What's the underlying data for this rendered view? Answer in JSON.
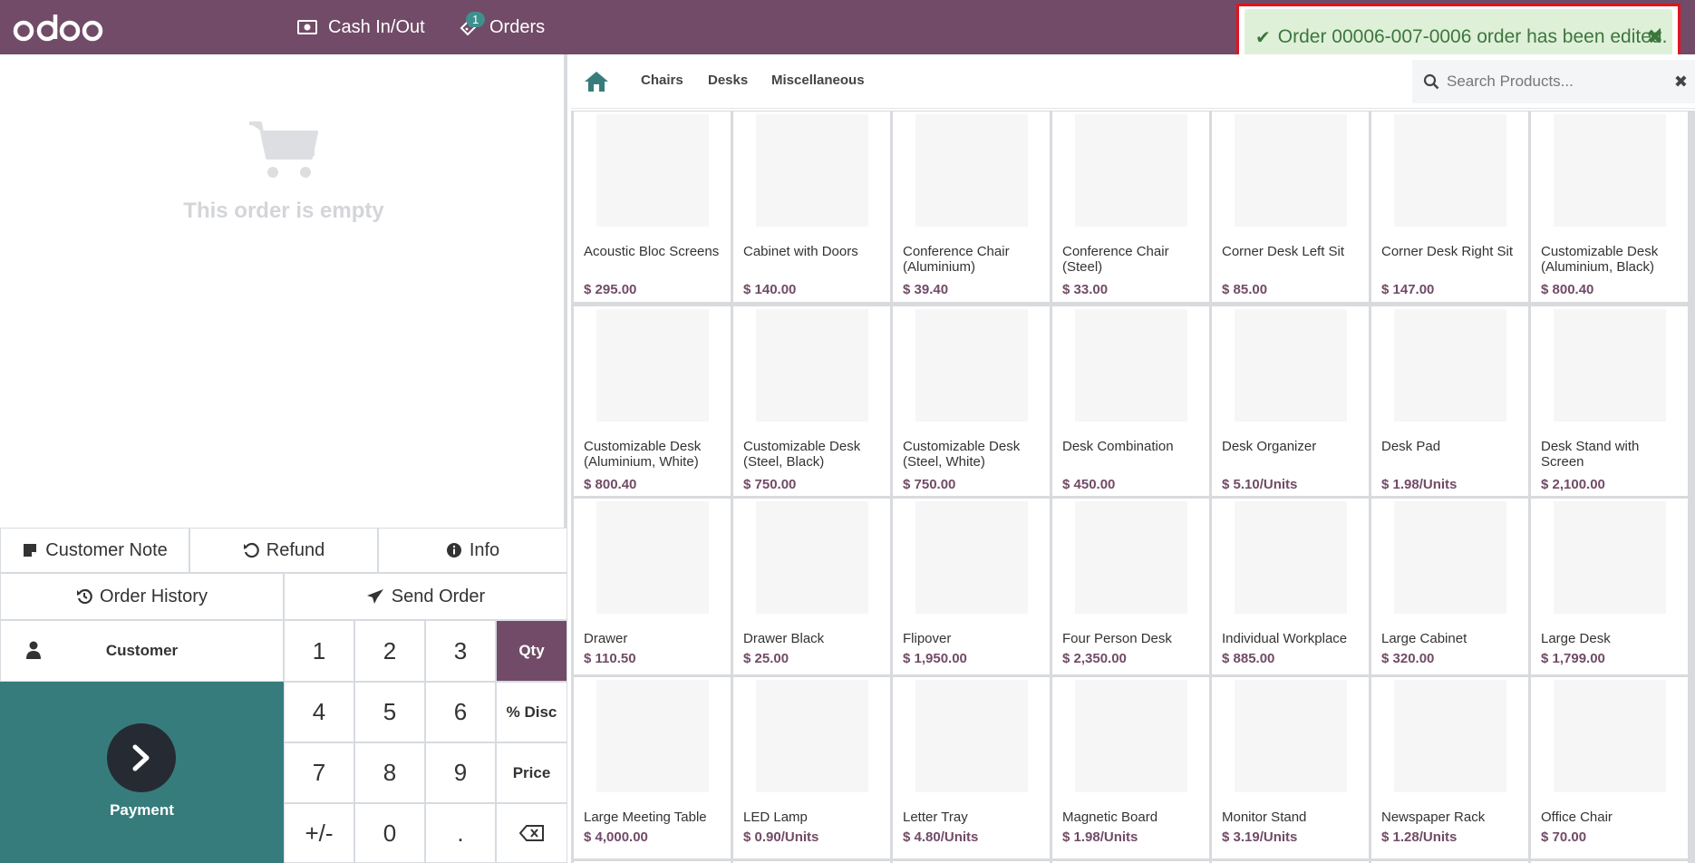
{
  "topbar": {
    "cash_label": "Cash In/Out",
    "orders_label": "Orders",
    "orders_badge": "1"
  },
  "toast": {
    "message": "Order 00006-007-0006 order has been edited.",
    "icon": "check-icon",
    "close": "✖"
  },
  "order": {
    "empty_text": "This order is empty"
  },
  "controls": {
    "customer_note": "Customer Note",
    "refund": "Refund",
    "info": "Info",
    "order_history": "Order History",
    "send_order": "Send Order"
  },
  "customer_label": "Customer",
  "payment_label": "Payment",
  "numpad": {
    "keys": [
      "1",
      "2",
      "3",
      "Qty",
      "4",
      "5",
      "6",
      "% Disc",
      "7",
      "8",
      "9",
      "Price",
      "+/-",
      "0",
      "."
    ],
    "active_mode": "Qty"
  },
  "categories": [
    "Chairs",
    "Desks",
    "Miscellaneous"
  ],
  "search": {
    "placeholder": "Search Products..."
  },
  "products": [
    {
      "name": "Acoustic Bloc Screens",
      "price": "$ 295.00"
    },
    {
      "name": "Cabinet with Doors",
      "price": "$ 140.00"
    },
    {
      "name": "Conference Chair (Aluminium)",
      "price": "$ 39.40"
    },
    {
      "name": "Conference Chair (Steel)",
      "price": "$ 33.00"
    },
    {
      "name": "Corner Desk Left Sit",
      "price": "$ 85.00"
    },
    {
      "name": "Corner Desk Right Sit",
      "price": "$ 147.00"
    },
    {
      "name": "Customizable Desk (Aluminium, Black)",
      "price": "$ 800.40"
    },
    {
      "name": "Customizable Desk (Aluminium, White)",
      "price": "$ 800.40"
    },
    {
      "name": "Customizable Desk (Steel, Black)",
      "price": "$ 750.00"
    },
    {
      "name": "Customizable Desk (Steel, White)",
      "price": "$ 750.00"
    },
    {
      "name": "Desk Combination",
      "price": "$ 450.00"
    },
    {
      "name": "Desk Organizer",
      "price": "$ 5.10/Units"
    },
    {
      "name": "Desk Pad",
      "price": "$ 1.98/Units"
    },
    {
      "name": "Desk Stand with Screen",
      "price": "$ 2,100.00"
    },
    {
      "name": "Drawer",
      "price": "$ 110.50"
    },
    {
      "name": "Drawer Black",
      "price": "$ 25.00"
    },
    {
      "name": "Flipover",
      "price": "$ 1,950.00"
    },
    {
      "name": "Four Person Desk",
      "price": "$ 2,350.00"
    },
    {
      "name": "Individual Workplace",
      "price": "$ 885.00"
    },
    {
      "name": "Large Cabinet",
      "price": "$ 320.00"
    },
    {
      "name": "Large Desk",
      "price": "$ 1,799.00"
    },
    {
      "name": "Large Meeting Table",
      "price": "$ 4,000.00"
    },
    {
      "name": "LED Lamp",
      "price": "$ 0.90/Units"
    },
    {
      "name": "Letter Tray",
      "price": "$ 4.80/Units"
    },
    {
      "name": "Magnetic Board",
      "price": "$ 1.98/Units"
    },
    {
      "name": "Monitor Stand",
      "price": "$ 3.19/Units"
    },
    {
      "name": "Newspaper Rack",
      "price": "$ 1.28/Units"
    },
    {
      "name": "Office Chair",
      "price": "$ 70.00"
    }
  ],
  "colors": {
    "brand": "#714b67",
    "teal": "#377c7c",
    "toast_bg": "#dff0d8",
    "toast_text": "#3c763d",
    "highlight": "#e0141e"
  }
}
